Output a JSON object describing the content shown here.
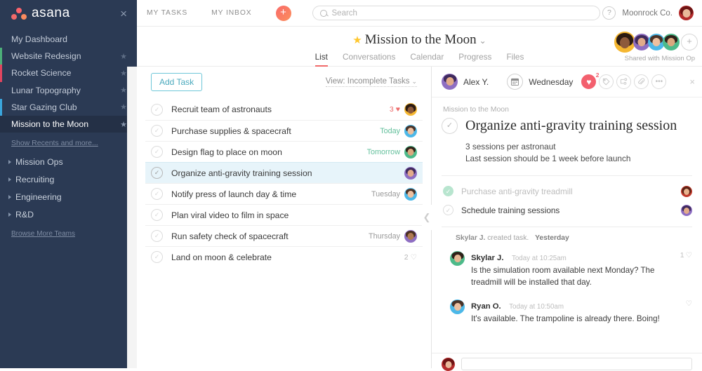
{
  "sidebar": {
    "brand": "asana",
    "close_icon": "×",
    "projects": [
      {
        "label": "My Dashboard",
        "starred": false,
        "accent": "",
        "active": false
      },
      {
        "label": "Website Redesign",
        "starred": true,
        "accent": "#4caf79",
        "active": false
      },
      {
        "label": "Rocket Science",
        "starred": true,
        "accent": "#e0455f",
        "active": false
      },
      {
        "label": "Lunar Topography",
        "starred": true,
        "accent": "",
        "active": false
      },
      {
        "label": "Star Gazing Club",
        "starred": true,
        "accent": "#3aa6dd",
        "active": false
      },
      {
        "label": "Mission to the Moon",
        "starred": true,
        "accent": "",
        "active": true
      }
    ],
    "show_recents": "Show Recents and more...",
    "teams": [
      {
        "label": "Mission Ops"
      },
      {
        "label": "Recruiting"
      },
      {
        "label": "Engineering"
      },
      {
        "label": "R&D"
      }
    ],
    "browse_more": "Browse More Teams"
  },
  "topbar": {
    "my_tasks": "MY TASKS",
    "my_inbox": "MY INBOX",
    "add_glyph": "+",
    "search_placeholder": "Search",
    "help_glyph": "?",
    "org_name": "Moonrock Co."
  },
  "project": {
    "star_glyph": "★",
    "title": "Mission to the Moon",
    "chevron": "⌄",
    "tabs": [
      {
        "label": "List",
        "active": true
      },
      {
        "label": "Conversations",
        "active": false
      },
      {
        "label": "Calendar",
        "active": false
      },
      {
        "label": "Progress",
        "active": false
      },
      {
        "label": "Files",
        "active": false
      }
    ],
    "shared_with": "Shared with Mission Op",
    "add_member_glyph": "+"
  },
  "list": {
    "add_task": "Add Task",
    "view_label": "View: Incomplete Tasks",
    "view_chevron": "⌄",
    "check_glyph": "✓",
    "collapse_glyph": "❮",
    "tasks": [
      {
        "name": "Recruit team of astronauts",
        "due": "",
        "due_soon": false,
        "likes": "3",
        "liked": true,
        "avatar": "fem-dark",
        "selected": false
      },
      {
        "name": "Purchase supplies & spacecraft",
        "due": "Today",
        "due_soon": true,
        "likes": "",
        "liked": false,
        "avatar": "male-blue",
        "selected": false
      },
      {
        "name": "Design flag to place on moon",
        "due": "Tomorrow",
        "due_soon": true,
        "likes": "",
        "liked": false,
        "avatar": "male-green",
        "selected": false
      },
      {
        "name": "Organize anti-gravity training session",
        "due": "",
        "due_soon": false,
        "likes": "",
        "liked": false,
        "avatar": "male-purple",
        "selected": true
      },
      {
        "name": "Notify press of launch day & time",
        "due": "Tuesday",
        "due_soon": false,
        "likes": "",
        "liked": false,
        "avatar": "male-blue",
        "selected": false
      },
      {
        "name": "Plan viral video to film in space",
        "due": "",
        "due_soon": false,
        "likes": "",
        "liked": false,
        "avatar": "",
        "selected": false
      },
      {
        "name": "Run safety check of spacecraft",
        "due": "Thursday",
        "due_soon": false,
        "likes": "",
        "liked": false,
        "avatar": "male-purple",
        "selected": false
      },
      {
        "name": "Land on moon & celebrate",
        "due": "",
        "due_soon": false,
        "likes": "2",
        "liked": false,
        "avatar": "",
        "selected": false
      }
    ]
  },
  "detail": {
    "assignee": "Alex Y.",
    "calendar_icon": "calendar-icon",
    "due_date": "Wednesday",
    "like_count": "2",
    "heart_glyph": "♥",
    "tag_icon": "tag-icon",
    "subtask_icon": "subtask-icon",
    "attach_icon": "paperclip-icon",
    "more_glyph": "•••",
    "close_glyph": "×",
    "project_name": "Mission to the Moon",
    "task_title": "Organize anti-gravity training session",
    "check_glyph": "✓",
    "description_line1": "3 sessions per astronaut",
    "description_line2": "Last session should be 1 week before launch",
    "subtasks": [
      {
        "name": "Purchase anti-gravity treadmill",
        "done": true,
        "avatar": "fem-red"
      },
      {
        "name": "Schedule training sessions",
        "done": false,
        "avatar": "male-purple"
      }
    ],
    "activity_author": "Skylar J.",
    "activity_action": "created task.",
    "activity_when": "Yesterday",
    "comments": [
      {
        "author": "Skylar J.",
        "time": "Today at 10:25am",
        "text": "Is the simulation room available next Monday? The treadmill will be installed that day.",
        "like_count": "1",
        "avatar": "fem-green"
      },
      {
        "author": "Ryan O.",
        "time": "Today at 10:50am",
        "text": "It's available. The trampoline is already there. Boing!",
        "like_count": "",
        "avatar": "male-blue"
      }
    ],
    "like_outline_glyph": "♡"
  },
  "colors": {
    "sidebar_bg": "#2b3a54",
    "sidebar_active": "#243046",
    "brand_red": "#f06a6a",
    "accent_teal": "#4aa9bd",
    "selection_blue": "#e7f4fa",
    "due_green": "#62bf9b",
    "like_red": "#f3606e",
    "star_yellow": "#ffc72e"
  }
}
